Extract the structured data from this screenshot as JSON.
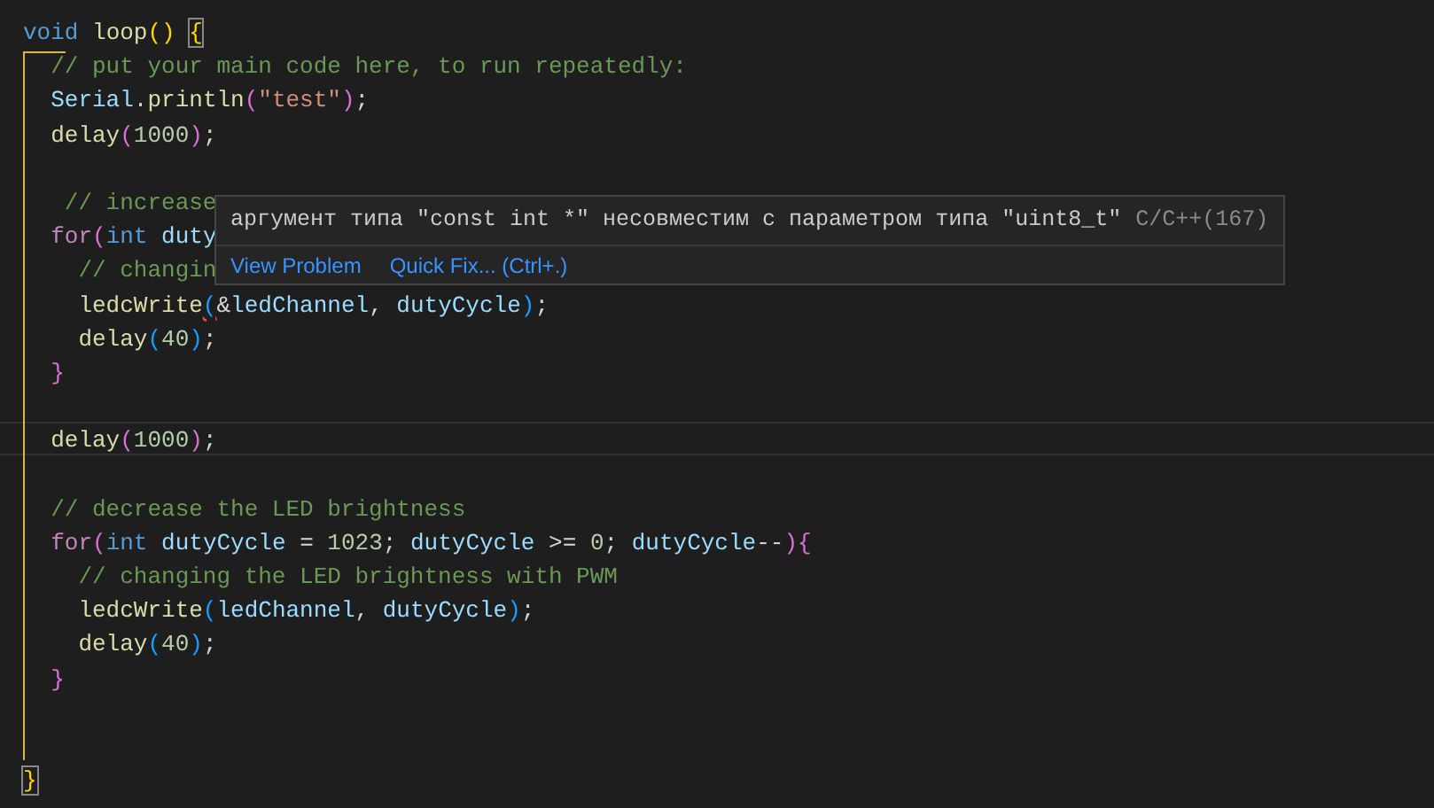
{
  "editor": {
    "lines": [
      {
        "current": false,
        "tokens": [
          {
            "text": "void ",
            "kind": "kw"
          },
          {
            "text": "loop",
            "kind": "fn"
          },
          {
            "text": "() ",
            "kind": "b1"
          },
          {
            "text": "{",
            "kind": "b1",
            "highlight": true
          }
        ]
      },
      {
        "current": false,
        "tokens": [
          {
            "text": "  // put your main code here, to run repeatedly:",
            "kind": "com"
          }
        ]
      },
      {
        "current": false,
        "tokens": [
          {
            "text": "  Serial",
            "kind": "var"
          },
          {
            "text": ".",
            "kind": "plain"
          },
          {
            "text": "println",
            "kind": "fn"
          },
          {
            "text": "(",
            "kind": "b2"
          },
          {
            "text": "\"test\"",
            "kind": "str"
          },
          {
            "text": ")",
            "kind": "b2"
          },
          {
            "text": ";",
            "kind": "plain"
          }
        ]
      },
      {
        "current": false,
        "tokens": [
          {
            "text": "  delay",
            "kind": "fn"
          },
          {
            "text": "(",
            "kind": "b2"
          },
          {
            "text": "1000",
            "kind": "num"
          },
          {
            "text": ")",
            "kind": "b2"
          },
          {
            "text": ";",
            "kind": "plain"
          }
        ]
      },
      {
        "current": false
      },
      {
        "current": false,
        "tokens": [
          {
            "text": "   // increase",
            "kind": "com"
          }
        ]
      },
      {
        "current": false,
        "tokens": [
          {
            "text": "  for",
            "kind": "ctl"
          },
          {
            "text": "(",
            "kind": "b2"
          },
          {
            "text": "int ",
            "kind": "kw"
          },
          {
            "text": "duty",
            "kind": "var"
          }
        ]
      },
      {
        "current": false,
        "tokens": [
          {
            "text": "    // changin",
            "kind": "com"
          }
        ]
      },
      {
        "current": false,
        "tokens": [
          {
            "text": "    ledcWrite",
            "kind": "fn"
          },
          {
            "text": "(",
            "kind": "b3",
            "squiggle": true
          },
          {
            "text": "&",
            "kind": "plain"
          },
          {
            "text": "ledChannel",
            "kind": "var"
          },
          {
            "text": ", ",
            "kind": "plain"
          },
          {
            "text": "dutyCycle",
            "kind": "var"
          },
          {
            "text": ")",
            "kind": "b3"
          },
          {
            "text": ";",
            "kind": "plain"
          }
        ]
      },
      {
        "current": false,
        "tokens": [
          {
            "text": "    delay",
            "kind": "fn"
          },
          {
            "text": "(",
            "kind": "b3"
          },
          {
            "text": "40",
            "kind": "num"
          },
          {
            "text": ")",
            "kind": "b3"
          },
          {
            "text": ";",
            "kind": "plain"
          }
        ]
      },
      {
        "current": false,
        "tokens": [
          {
            "text": "  }",
            "kind": "b2"
          }
        ]
      },
      {
        "current": false
      },
      {
        "current": true,
        "tokens": [
          {
            "text": "  delay",
            "kind": "fn"
          },
          {
            "text": "(",
            "kind": "b2"
          },
          {
            "text": "1000",
            "kind": "num"
          },
          {
            "text": ")",
            "kind": "b2"
          },
          {
            "text": ";",
            "kind": "plain"
          }
        ]
      },
      {
        "current": false
      },
      {
        "current": false,
        "tokens": [
          {
            "text": "  // decrease the LED brightness",
            "kind": "com"
          }
        ]
      },
      {
        "current": false,
        "tokens": [
          {
            "text": "  for",
            "kind": "ctl"
          },
          {
            "text": "(",
            "kind": "b2"
          },
          {
            "text": "int ",
            "kind": "kw"
          },
          {
            "text": "dutyCycle",
            "kind": "var"
          },
          {
            "text": " = ",
            "kind": "plain"
          },
          {
            "text": "1023",
            "kind": "num"
          },
          {
            "text": "; ",
            "kind": "plain"
          },
          {
            "text": "dutyCycle",
            "kind": "var"
          },
          {
            "text": " >= ",
            "kind": "plain"
          },
          {
            "text": "0",
            "kind": "num"
          },
          {
            "text": "; ",
            "kind": "plain"
          },
          {
            "text": "dutyCycle",
            "kind": "var"
          },
          {
            "text": "--",
            "kind": "plain"
          },
          {
            "text": "){",
            "kind": "b2"
          }
        ]
      },
      {
        "current": false,
        "tokens": [
          {
            "text": "    // changing the LED brightness with PWM",
            "kind": "com"
          }
        ]
      },
      {
        "current": false,
        "tokens": [
          {
            "text": "    ledcWrite",
            "kind": "fn"
          },
          {
            "text": "(",
            "kind": "b3"
          },
          {
            "text": "ledChannel",
            "kind": "var"
          },
          {
            "text": ", ",
            "kind": "plain"
          },
          {
            "text": "dutyCycle",
            "kind": "var"
          },
          {
            "text": ")",
            "kind": "b3"
          },
          {
            "text": ";",
            "kind": "plain"
          }
        ]
      },
      {
        "current": false,
        "tokens": [
          {
            "text": "    delay",
            "kind": "fn"
          },
          {
            "text": "(",
            "kind": "b3"
          },
          {
            "text": "40",
            "kind": "num"
          },
          {
            "text": ")",
            "kind": "b3"
          },
          {
            "text": ";",
            "kind": "plain"
          }
        ]
      },
      {
        "current": false,
        "tokens": [
          {
            "text": "  }",
            "kind": "b2"
          }
        ]
      },
      {
        "current": false
      },
      {
        "current": false
      },
      {
        "current": false,
        "tokens": [
          {
            "text": "}",
            "kind": "b1",
            "highlight": true
          }
        ]
      }
    ]
  },
  "hover": {
    "message": "аргумент типа \"const int *\" несовместим с параметром типа \"uint8_t\"",
    "source": "C/C++(167)",
    "actions": [
      "View Problem",
      "Quick Fix... (Ctrl+.)"
    ]
  }
}
